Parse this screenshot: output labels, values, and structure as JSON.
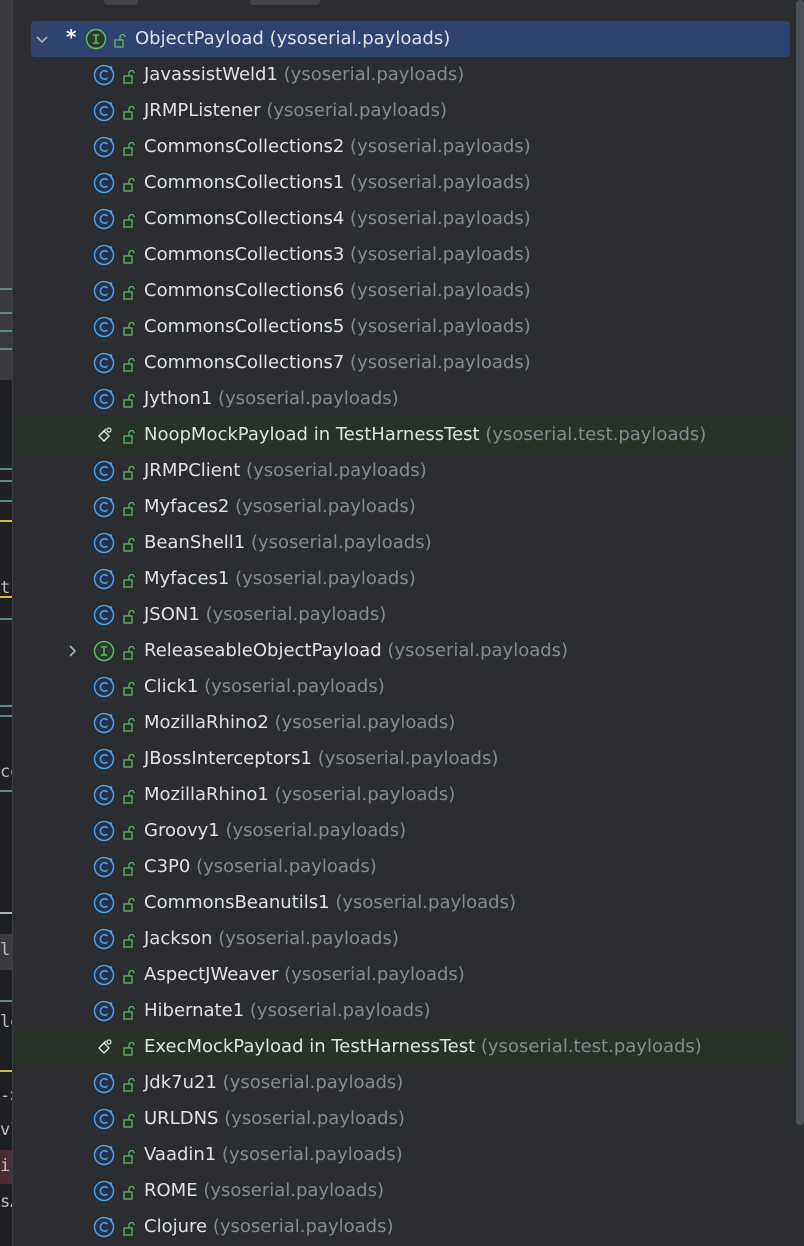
{
  "tree": {
    "root": {
      "name": "ObjectPayload",
      "package": "(ysoserial.payloads)",
      "marker": "*"
    },
    "items": [
      {
        "name": "JavassistWeld1",
        "package": "(ysoserial.payloads)",
        "kind": "class"
      },
      {
        "name": "JRMPListener",
        "package": "(ysoserial.payloads)",
        "kind": "class"
      },
      {
        "name": "CommonsCollections2",
        "package": "(ysoserial.payloads)",
        "kind": "class"
      },
      {
        "name": "CommonsCollections1",
        "package": "(ysoserial.payloads)",
        "kind": "class"
      },
      {
        "name": "CommonsCollections4",
        "package": "(ysoserial.payloads)",
        "kind": "class"
      },
      {
        "name": "CommonsCollections3",
        "package": "(ysoserial.payloads)",
        "kind": "class"
      },
      {
        "name": "CommonsCollections6",
        "package": "(ysoserial.payloads)",
        "kind": "class"
      },
      {
        "name": "CommonsCollections5",
        "package": "(ysoserial.payloads)",
        "kind": "class"
      },
      {
        "name": "CommonsCollections7",
        "package": "(ysoserial.payloads)",
        "kind": "class"
      },
      {
        "name": "Jython1",
        "package": "(ysoserial.payloads)",
        "kind": "class"
      },
      {
        "name": "NoopMockPayload in TestHarnessTest",
        "package": "(ysoserial.test.payloads)",
        "kind": "test-class"
      },
      {
        "name": "JRMPClient",
        "package": "(ysoserial.payloads)",
        "kind": "class"
      },
      {
        "name": "Myfaces2",
        "package": "(ysoserial.payloads)",
        "kind": "class"
      },
      {
        "name": "BeanShell1",
        "package": "(ysoserial.payloads)",
        "kind": "class"
      },
      {
        "name": "Myfaces1",
        "package": "(ysoserial.payloads)",
        "kind": "class"
      },
      {
        "name": "JSON1",
        "package": "(ysoserial.payloads)",
        "kind": "class"
      },
      {
        "name": "ReleaseableObjectPayload",
        "package": "(ysoserial.payloads)",
        "kind": "interface"
      },
      {
        "name": "Click1",
        "package": "(ysoserial.payloads)",
        "kind": "class"
      },
      {
        "name": "MozillaRhino2",
        "package": "(ysoserial.payloads)",
        "kind": "class"
      },
      {
        "name": "JBossInterceptors1",
        "package": "(ysoserial.payloads)",
        "kind": "class"
      },
      {
        "name": "MozillaRhino1",
        "package": "(ysoserial.payloads)",
        "kind": "class"
      },
      {
        "name": "Groovy1",
        "package": "(ysoserial.payloads)",
        "kind": "class"
      },
      {
        "name": "C3P0",
        "package": "(ysoserial.payloads)",
        "kind": "class"
      },
      {
        "name": "CommonsBeanutils1",
        "package": "(ysoserial.payloads)",
        "kind": "class"
      },
      {
        "name": "Jackson",
        "package": "(ysoserial.payloads)",
        "kind": "class"
      },
      {
        "name": "AspectJWeaver",
        "package": "(ysoserial.payloads)",
        "kind": "class"
      },
      {
        "name": "Hibernate1",
        "package": "(ysoserial.payloads)",
        "kind": "class"
      },
      {
        "name": "ExecMockPayload in TestHarnessTest",
        "package": "(ysoserial.test.payloads)",
        "kind": "test-class"
      },
      {
        "name": "Jdk7u21",
        "package": "(ysoserial.payloads)",
        "kind": "class"
      },
      {
        "name": "URLDNS",
        "package": "(ysoserial.payloads)",
        "kind": "class"
      },
      {
        "name": "Vaadin1",
        "package": "(ysoserial.payloads)",
        "kind": "class"
      },
      {
        "name": "ROME",
        "package": "(ysoserial.payloads)",
        "kind": "class"
      },
      {
        "name": "Clojure",
        "package": "(ysoserial.payloads)",
        "kind": "class"
      }
    ]
  },
  "editor_fragments": [
    "t",
    "ce",
    "lc",
    "le",
    "->",
    "vl",
    "i",
    "sA"
  ],
  "colors": {
    "background": "#2b2d30",
    "selection": "#2e436e",
    "test_row_highlight": "#283228",
    "class_icon": "#4f9ee8",
    "interface_icon": "#5fb865",
    "package_text": "#868a91"
  }
}
